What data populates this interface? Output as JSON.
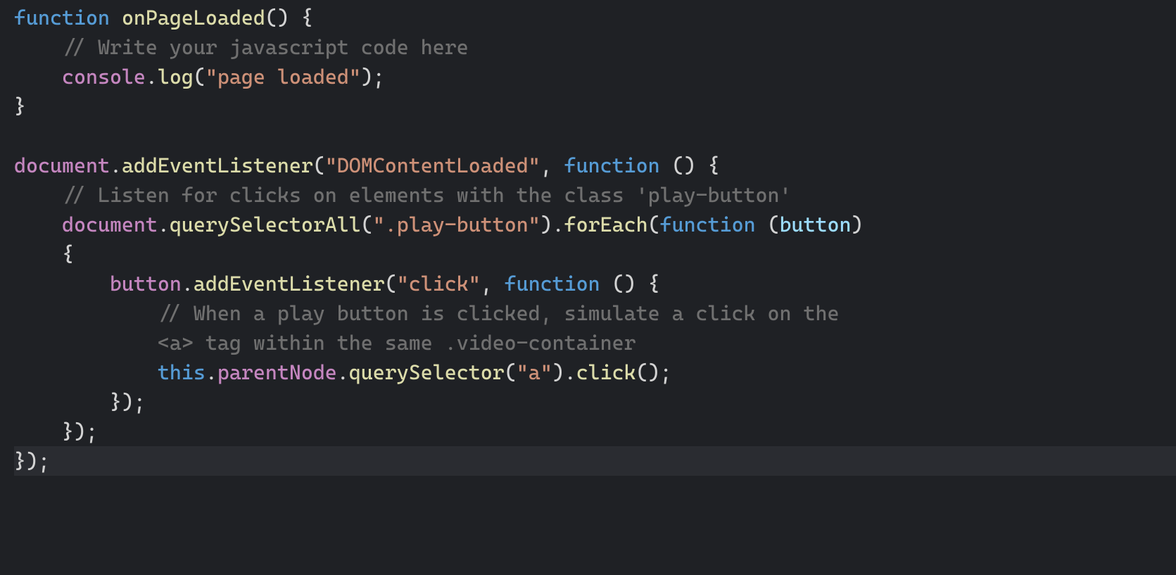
{
  "code": {
    "l1": {
      "kw_function": "function",
      "name": "onPageLoaded",
      "parens": "()",
      "brace": " {"
    },
    "l2": {
      "comment": "// Write your javascript code here"
    },
    "l3": {
      "ident": "console",
      "dot": ".",
      "method": "log",
      "open": "(",
      "str": "\"page loaded\"",
      "close": ");"
    },
    "l4": {
      "brace": "}"
    },
    "l5": {
      "blank": ""
    },
    "l6": {
      "ident": "document",
      "dot": ".",
      "method": "addEventListener",
      "open": "(",
      "str": "\"DOMContentLoaded\"",
      "comma": ", ",
      "kw_function": "function",
      "space": " ",
      "parens": "()",
      "brace": " {"
    },
    "l7": {
      "comment": "// Listen for clicks on elements with the class 'play-button'"
    },
    "l8": {
      "ident": "document",
      "dot": ".",
      "method": "querySelectorAll",
      "open": "(",
      "str": "\".play-button\"",
      "close": ")",
      "dot2": ".",
      "method2": "forEach",
      "open2": "(",
      "kw_function": "function",
      "space": " ",
      "paren_open": "(",
      "param": "button",
      "paren_close": ") "
    },
    "l8b": {
      "brace": "{"
    },
    "l9": {
      "ident": "button",
      "dot": ".",
      "method": "addEventListener",
      "open": "(",
      "str": "\"click\"",
      "comma": ", ",
      "kw_function": "function",
      "space": " ",
      "parens": "()",
      "brace": " {"
    },
    "l10": {
      "comment": "// When a play button is clicked, simulate a click on the "
    },
    "l10b": {
      "comment": "<a> tag within the same .video-container"
    },
    "l11": {
      "this": "this",
      "dot": ".",
      "prop1": "parentNode",
      "dot2": ".",
      "method": "querySelector",
      "open": "(",
      "str": "\"a\"",
      "close": ")",
      "dot3": ".",
      "method2": "click",
      "end": "();"
    },
    "l12": {
      "close": "});"
    },
    "l13": {
      "close": "});"
    },
    "l14": {
      "close": "});"
    }
  }
}
